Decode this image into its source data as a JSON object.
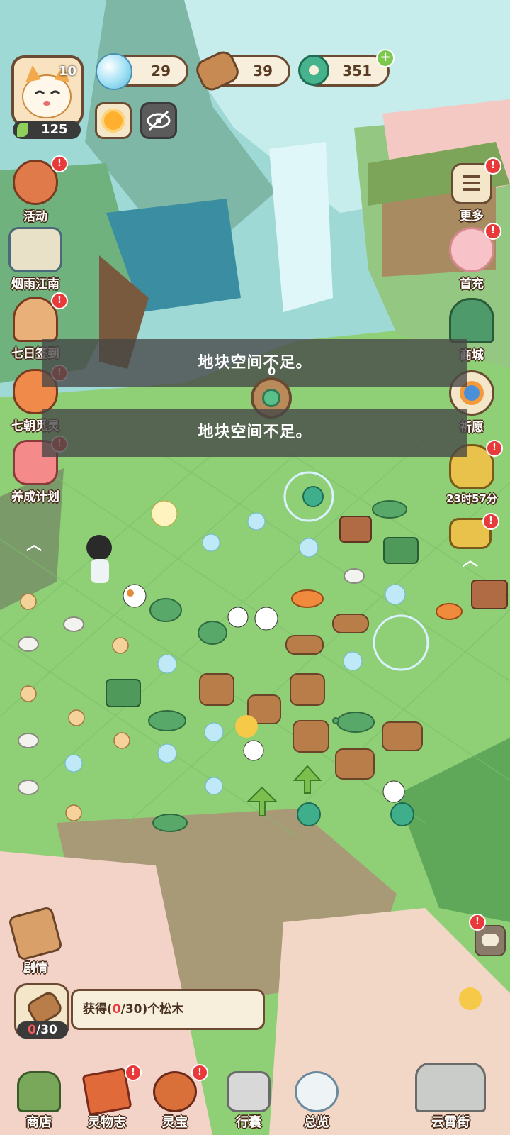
{
  "player": {
    "level": "10",
    "energy": "125"
  },
  "resources": {
    "bubbles": "29",
    "wood": "39",
    "jade_coins": "351"
  },
  "left_menu": [
    {
      "label": "活动",
      "badge": "!"
    },
    {
      "label": "烟雨江南",
      "badge": ""
    },
    {
      "label": "七日签到",
      "badge": "!"
    },
    {
      "label": "七朝觅灵",
      "badge": "!"
    },
    {
      "label": "养成计划",
      "badge": "!"
    }
  ],
  "right_menu": [
    {
      "label": "更多",
      "badge": "!"
    },
    {
      "label": "首充",
      "badge": "!"
    },
    {
      "label": "商城",
      "badge": ""
    },
    {
      "label": "祈愿",
      "badge": ""
    },
    {
      "label": "23时57分",
      "badge": "!"
    }
  ],
  "toasts": [
    "地块空间不足。",
    "地块空间不足。"
  ],
  "center_badge": "0",
  "story_button": "剧情",
  "quest": {
    "prefix": "获得(",
    "current": "0",
    "suffix": "/30)个松木",
    "progress_current": "0",
    "progress_total": "/30"
  },
  "bottom_nav": [
    {
      "label": "商店",
      "badge": ""
    },
    {
      "label": "灵物志",
      "badge": "!"
    },
    {
      "label": "灵宝",
      "badge": "!"
    },
    {
      "label": "行囊",
      "badge": ""
    },
    {
      "label": "总览",
      "badge": ""
    },
    {
      "label": "云霄街",
      "badge": ""
    }
  ],
  "colors": {
    "accent_red": "#e8393b",
    "hud_brown": "#6a4a32",
    "grass": "#8fd07a",
    "quest_red": "#e8393b"
  }
}
